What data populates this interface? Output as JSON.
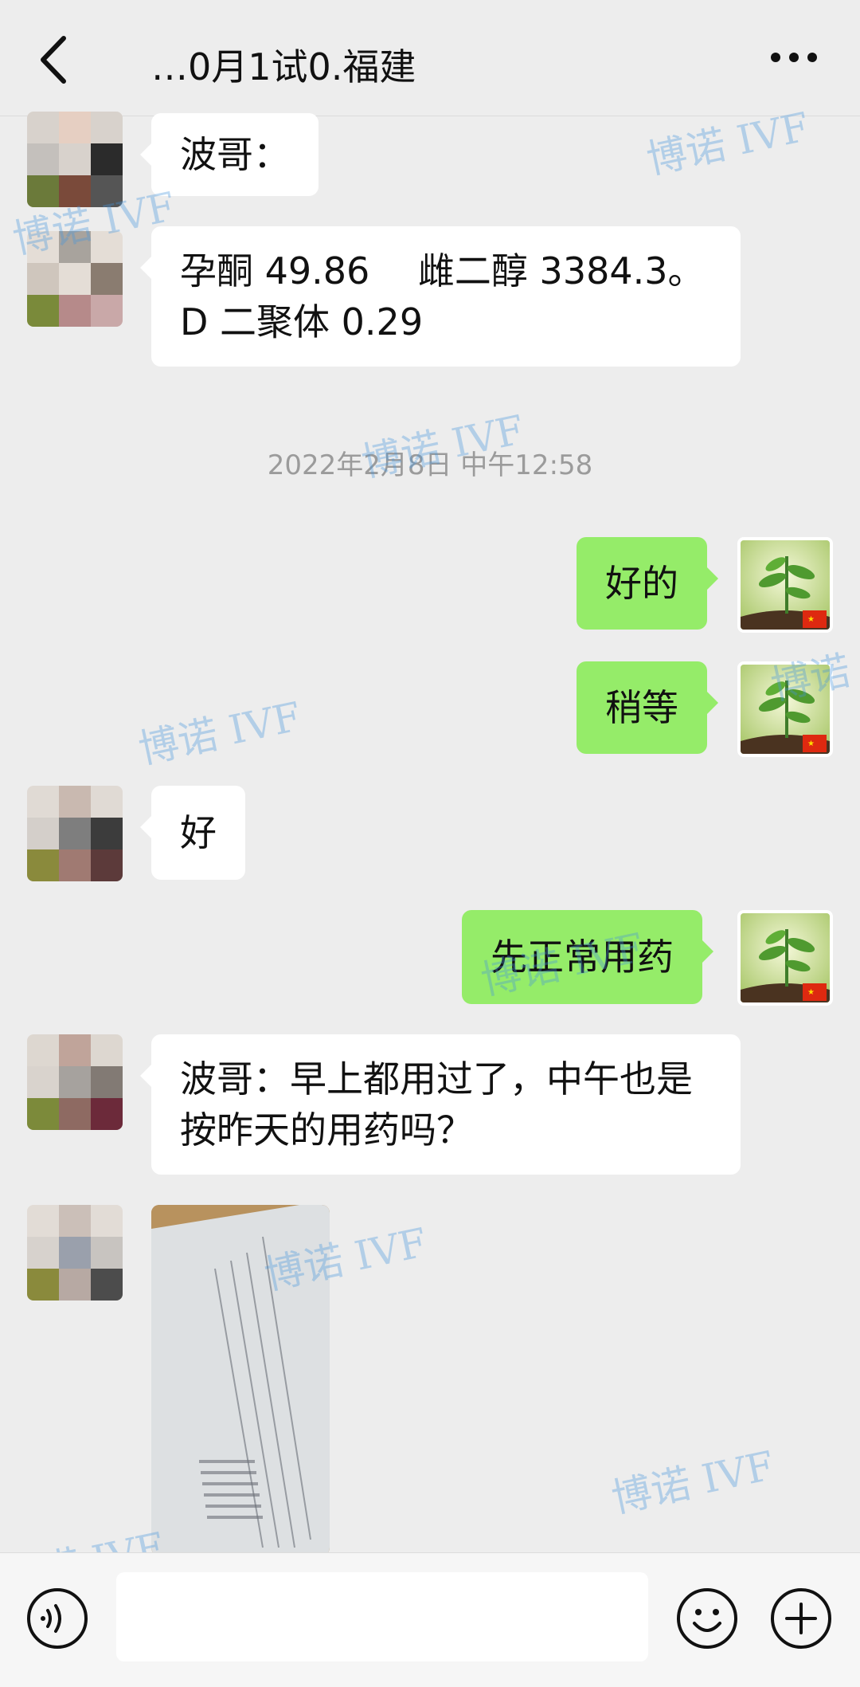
{
  "header": {
    "title": "…0月1试0.福建"
  },
  "messages": [
    {
      "side": "left",
      "text": "波哥："
    },
    {
      "side": "left",
      "lines": [
        "孕酮 49.86　 雌二醇 3384.3。",
        "D 二聚体 0.29"
      ]
    },
    {
      "side": "right",
      "text": "好的"
    },
    {
      "side": "right",
      "text": "稍等"
    },
    {
      "side": "left",
      "text": "好"
    },
    {
      "side": "right",
      "text": "先正常用药"
    },
    {
      "side": "left",
      "lines": [
        "波哥：早上都用过了，中午也是",
        "按昨天的用药吗？"
      ]
    }
  ],
  "timestamp": "2022年2月8日 中午12:58",
  "watermark": "博诺 IVF",
  "colors": {
    "background": "#ededed",
    "sent_bubble": "#95ec69",
    "received_bubble": "#ffffff",
    "watermark": "#4696dc"
  },
  "icons": {
    "back": "back-arrow-icon",
    "more": "more-icon",
    "voice": "voice-icon",
    "emoji": "emoji-icon",
    "plus": "plus-icon"
  }
}
